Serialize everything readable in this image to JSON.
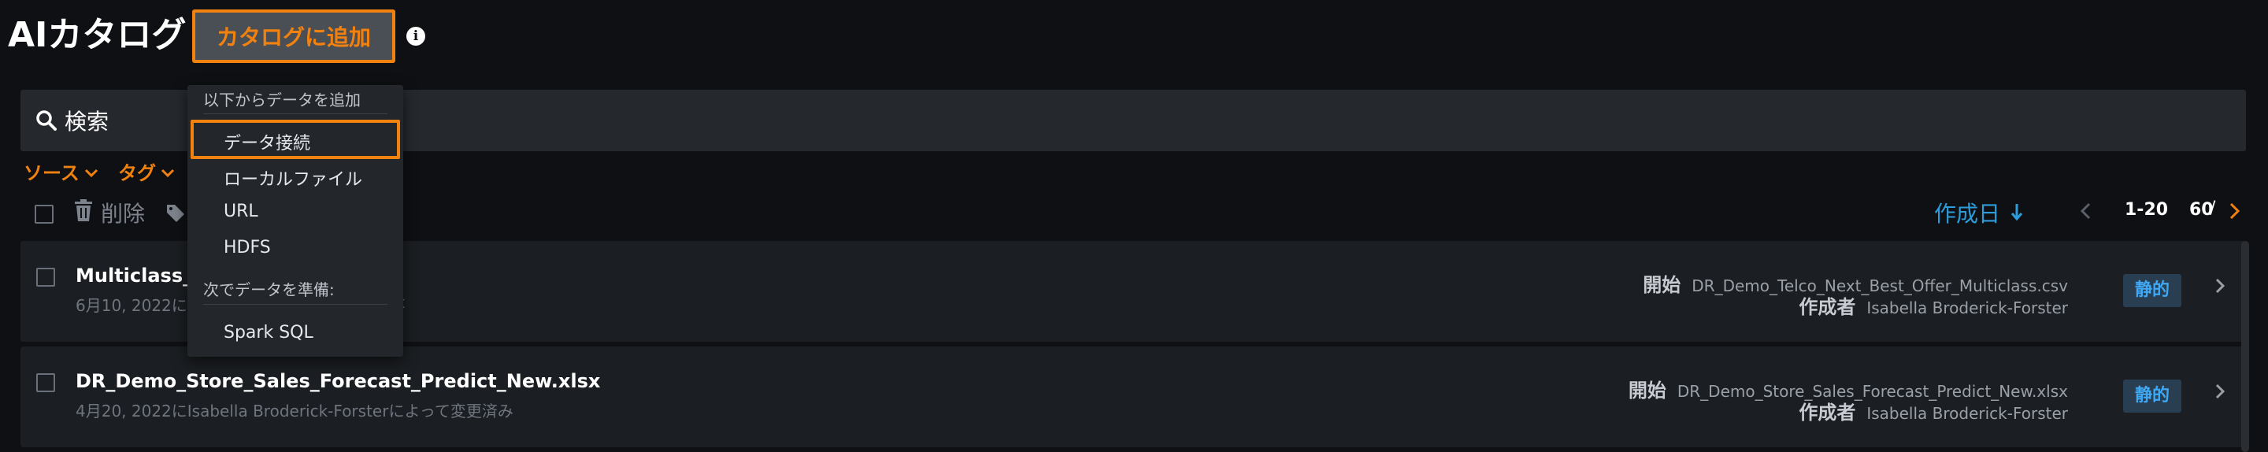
{
  "header": {
    "title": "AIカタログ",
    "add_button": "カタログに追加",
    "info_icon": "info-icon"
  },
  "search": {
    "label": "検索"
  },
  "filters": [
    {
      "label": "ソース"
    },
    {
      "label": "タグ"
    }
  ],
  "toolbar": {
    "delete_label": "削除"
  },
  "sort": {
    "label": "作成日"
  },
  "pagination": {
    "range": "1-20",
    "separator": "/",
    "total": "60"
  },
  "dropdown": {
    "section1": "以下からデータを追加",
    "items1": [
      "データ接続",
      "ローカルファイル",
      "URL",
      "HDFS"
    ],
    "section2": "次でデータを準備:",
    "items2": [
      "Spark SQL"
    ]
  },
  "rows": [
    {
      "name": "Multiclass_N",
      "sub": "6月10, 2022に",
      "sub_tail": "t",
      "source_key": "開始",
      "source_val": "DR_Demo_Telco_Next_Best_Offer_Multiclass.csv",
      "author_key": "作成者",
      "author_val": "Isabella Broderick-Forster",
      "badge": "静的"
    },
    {
      "name": "DR_Demo_Store_Sales_Forecast_Predict_New.xlsx",
      "sub": "4月20, 2022にIsabella Broderick-Forsterによって変更済み",
      "source_key": "開始",
      "source_val": "DR_Demo_Store_Sales_Forecast_Predict_New.xlsx",
      "author_key": "作成者",
      "author_val": "Isabella Broderick-Forster",
      "badge": "静的"
    }
  ],
  "colors": {
    "background": "#0e1013",
    "accent_orange": "#f2820f",
    "accent_blue": "#2d9cdb",
    "badge_bg": "#2a3e52"
  }
}
